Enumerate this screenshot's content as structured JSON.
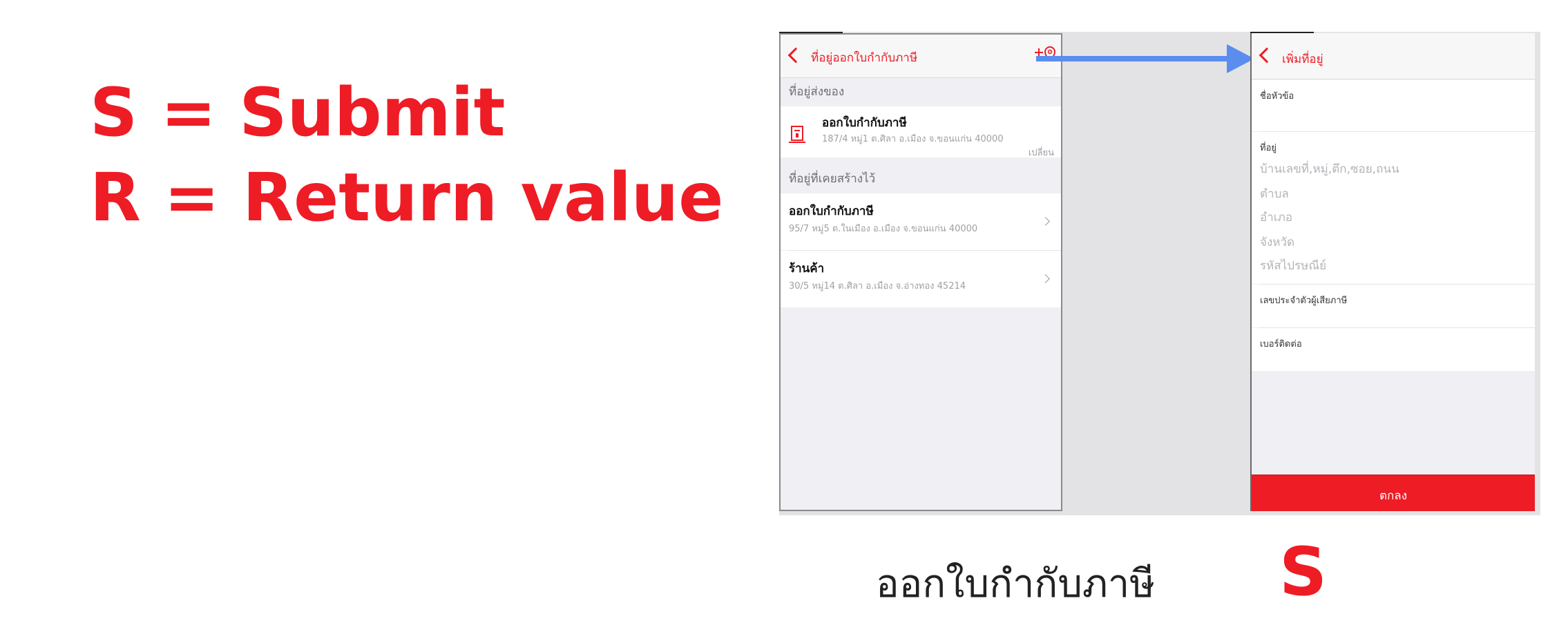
{
  "legend": {
    "line1": "S = Submit",
    "line2": "R = Return value"
  },
  "colors": {
    "accent": "#ee1c25",
    "arrow": "#5b8def"
  },
  "left_screen": {
    "title": "ที่อยู่ออกใบกำกับภาษี",
    "add_icon": "add-location-icon",
    "sections": [
      {
        "header": "ที่อยู่ส่งของ",
        "items": [
          {
            "title": "ออกใบกำกับภาษี",
            "subtitle": "187/4 หมู่1 ต.ศิลา อ.เมือง จ.ขอนแก่น 40000",
            "action": "เปลี่ยน"
          }
        ]
      },
      {
        "header": "ที่อยู่ที่เคยสร้างไว้",
        "items": [
          {
            "title": "ออกใบกำกับภาษี",
            "subtitle": "95/7 หมู่5 ต.ในเมือง อ.เมือง จ.ขอนแก่น 40000"
          },
          {
            "title": "ร้านค้า",
            "subtitle": "30/5 หมู่14 ต.ศิลา อ.เมือง จ.อ่างทอง 45214"
          }
        ]
      }
    ]
  },
  "right_screen": {
    "title": "เพิ่มที่อยู่",
    "fields": {
      "name_label": "ชื่อหัวข้อ",
      "address_label": "ที่อยู่",
      "address_placeholder": "บ้านเลขที่,หมู่,ตึก,ซอย,ถนน",
      "subdistrict_placeholder": "ตำบล",
      "district_placeholder": "อำเภอ",
      "province_placeholder": "จังหวัด",
      "postcode_placeholder": "รหัสไปรษณีย์",
      "taxid_label": "เลขประจำตัวผู้เสียภาษี",
      "phone_label": "เบอร์ติดต่อ"
    },
    "submit_label": "ตกลง"
  },
  "captions": {
    "left": "ออกใบกำกับภาษี",
    "right": "S"
  }
}
